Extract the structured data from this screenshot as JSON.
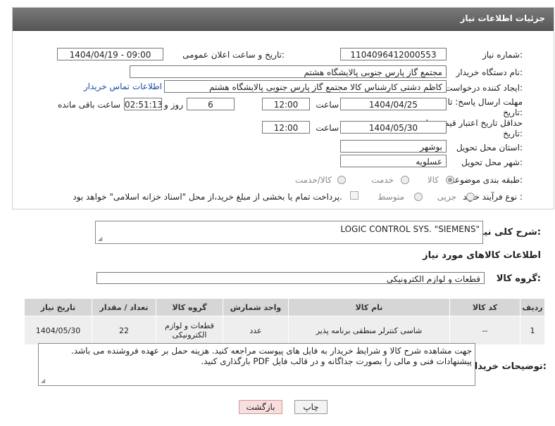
{
  "header": {
    "title": "جزئیات اطلاعات نیاز"
  },
  "form": {
    "need_number": {
      "label": "شماره نیاز:",
      "value": "1104096412000553"
    },
    "announce": {
      "label": "تاریخ و ساعت اعلان عمومی:",
      "value": "1404/04/19 - 09:00"
    },
    "buyer_org": {
      "label": "نام دستگاه خریدار:",
      "value": "مجتمع گاز پارس جنوبی  پالایشگاه هشتم"
    },
    "requester": {
      "label": "ایجاد کننده درخواست:",
      "value": "کاظم دشتی کارشناس کالا مجتمع گاز پارس جنوبی  پالایشگاه هشتم",
      "contact_link": "اطلاعات تماس خریدار"
    },
    "reply_deadline": {
      "label": "مهلت ارسال پاسخ: تا تاریخ:",
      "date": "1404/04/25",
      "time_label": "ساعت",
      "time": "12:00",
      "days": "6",
      "days_label": "روز و",
      "remaining": "02:51:13",
      "remaining_label": "ساعت باقی مانده"
    },
    "price_validity": {
      "label": "حداقل تاریخ اعتبار قیمت: تا تاریخ:",
      "date": "1404/05/30",
      "time_label": "ساعت",
      "time": "12:00"
    },
    "province": {
      "label": "استان محل تحویل:",
      "value": "بوشهر"
    },
    "city": {
      "label": "شهر محل تحویل:",
      "value": "عسلویه"
    },
    "category": {
      "label": "طبقه بندی موضوعی:",
      "options": [
        "کالا",
        "خدمت",
        "کالا/خدمت"
      ],
      "selected": "کالا"
    },
    "process": {
      "label": "نوع فرآیند خرید :",
      "options": [
        "جزیی",
        "متوسط"
      ],
      "payment_note": "پرداخت تمام یا بخشی از مبلغ خرید،از محل \"اسناد خزانه اسلامی\" خواهد بود."
    }
  },
  "summary": {
    "label": "شرح کلی نیاز:",
    "value": "LOGIC CONTROL SYS. \"SIEMENS\""
  },
  "goods_info": {
    "title": "اطلاعات کالاهای مورد نیاز"
  },
  "goods_group": {
    "label": "گروه کالا:",
    "value": "قطعات و لوازم الکترونیکی"
  },
  "table": {
    "headers": [
      "ردیف",
      "کد کالا",
      "نام کالا",
      "واحد شمارش",
      "گروه کالا",
      "تعداد / مقدار",
      "تاریخ نیاز"
    ],
    "rows": [
      [
        "1",
        "--",
        "شاسی کنترلر منطقی برنامه پذیر",
        "عدد",
        "قطعات و لوازم الکترونیکی",
        "22",
        "1404/05/30"
      ]
    ]
  },
  "buyer_notes": {
    "label": "توضیحات خریدار:",
    "line1": "جهت مشاهده شرح کالا و شرایط خریدار به فایل های پیوست مراجعه کنید. هزینه حمل بر عهده فروشنده می باشد.",
    "line2": "پیشنهادات فنی و مالی را بصورت جداگانه و در قالب فایل PDF بارگذاری کنید."
  },
  "buttons": {
    "print": "چاپ",
    "back": "بازگشت"
  },
  "colors": {
    "header_bg": "#5f5f5f",
    "link": "#1a4fa3",
    "table_header": "#d6d6d6",
    "back_button": "#f9dede"
  }
}
